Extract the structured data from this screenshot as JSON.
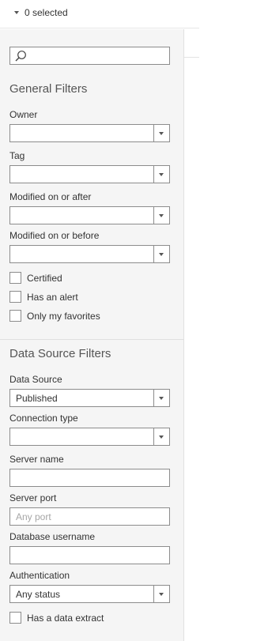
{
  "header": {
    "selected_label": "0 selected"
  },
  "search": {
    "placeholder": ""
  },
  "general_filters": {
    "title": "General Filters",
    "owner": {
      "label": "Owner",
      "value": ""
    },
    "tag": {
      "label": "Tag",
      "value": ""
    },
    "modified_after": {
      "label": "Modified on or after",
      "value": ""
    },
    "modified_before": {
      "label": "Modified on or before",
      "value": ""
    },
    "checkboxes": [
      {
        "label": "Certified",
        "checked": false
      },
      {
        "label": "Has an alert",
        "checked": false
      },
      {
        "label": "Only my favorites",
        "checked": false
      }
    ]
  },
  "data_source_filters": {
    "title": "Data Source Filters",
    "data_source": {
      "label": "Data Source",
      "value": "Published"
    },
    "connection_type": {
      "label": "Connection type",
      "value": ""
    },
    "server_name": {
      "label": "Server name",
      "value": ""
    },
    "server_port": {
      "label": "Server port",
      "placeholder": "Any port"
    },
    "database_username": {
      "label": "Database username",
      "value": ""
    },
    "authentication": {
      "label": "Authentication",
      "value": "Any status"
    },
    "extract_checkbox": {
      "label": "Has a data extract",
      "checked": false
    }
  },
  "colors": {
    "panel_bg": "#f5f5f5",
    "border": "#8c8c8c",
    "text": "#333333",
    "placeholder": "#a6a6a6"
  }
}
